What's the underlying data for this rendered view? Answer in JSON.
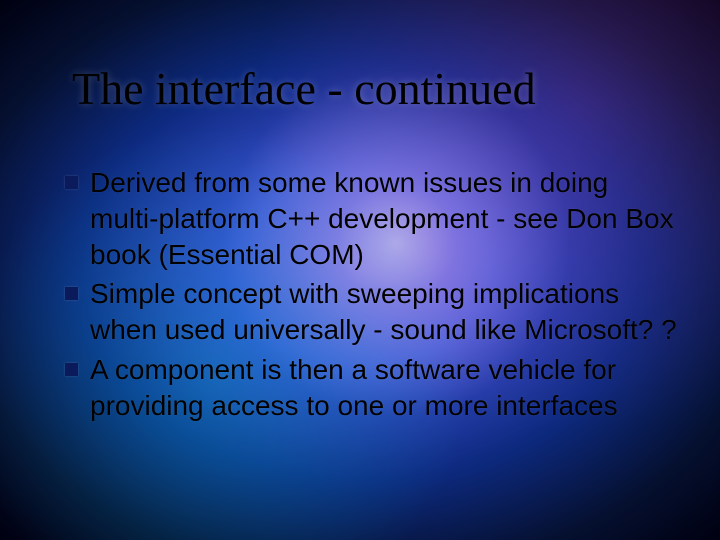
{
  "slide": {
    "title": "The interface - continued",
    "bullets": [
      "Derived from some known issues in doing multi-platform C++ development - see Don Box book (Essential COM)",
      "Simple concept with sweeping implications when used universally - sound like Microsoft? ?",
      "A component is then a software vehicle for providing access to one or more interfaces"
    ]
  }
}
